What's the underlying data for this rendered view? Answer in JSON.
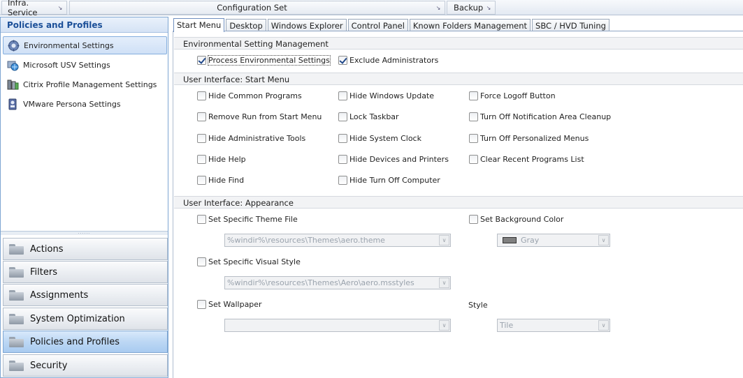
{
  "topbar": {
    "infra": "Infra. Service",
    "config": "Configuration Set",
    "backup": "Backup"
  },
  "left_panel": {
    "header": "Policies and Profiles",
    "items": [
      {
        "label": "Environmental Settings",
        "icon": "environment-gear-icon",
        "selected": true
      },
      {
        "label": "Microsoft USV Settings",
        "icon": "usv-globe-icon"
      },
      {
        "label": "Citrix Profile Management Settings",
        "icon": "citrix-servers-icon"
      },
      {
        "label": "VMware Persona Settings",
        "icon": "vmware-persona-icon"
      }
    ],
    "splitter": "......",
    "buckets": [
      {
        "label": "Actions",
        "icon": "folder-icon"
      },
      {
        "label": "Filters",
        "icon": "folder-icon"
      },
      {
        "label": "Assignments",
        "icon": "folder-icon"
      },
      {
        "label": "System Optimization",
        "icon": "folder-icon"
      },
      {
        "label": "Policies and Profiles",
        "icon": "folder-icon",
        "active": true
      },
      {
        "label": "Security",
        "icon": "folder-icon"
      }
    ]
  },
  "tabs": [
    {
      "label": "Start Menu",
      "active": true
    },
    {
      "label": "Desktop"
    },
    {
      "label": "Windows Explorer"
    },
    {
      "label": "Control Panel"
    },
    {
      "label": "Known Folders Management"
    },
    {
      "label": "SBC / HVD Tuning"
    }
  ],
  "sections": {
    "esm": {
      "title": "Environmental Setting Management",
      "process": {
        "label": "Process Environmental Settings",
        "checked": true
      },
      "exclude": {
        "label": "Exclude Administrators",
        "checked": true
      }
    },
    "start_menu": {
      "title": "User Interface: Start Menu",
      "col1": [
        "Hide Common Programs",
        "Remove Run from Start Menu",
        "Hide Administrative Tools",
        "Hide Help",
        "Hide Find"
      ],
      "col2": [
        "Hide Windows Update",
        "Lock Taskbar",
        "Hide System Clock",
        "Hide Devices and Printers",
        "Hide Turn Off Computer"
      ],
      "col3": [
        "Force Logoff Button",
        "Turn Off Notification Area Cleanup",
        "Turn Off Personalized Menus",
        "Clear Recent Programs List"
      ]
    },
    "appearance": {
      "title": "User Interface: Appearance",
      "theme": {
        "label": "Set Specific Theme File",
        "value": "%windir%\\resources\\Themes\\aero.theme"
      },
      "bgcolor": {
        "label": "Set Background Color",
        "value": "Gray",
        "swatch": "#808080"
      },
      "visual": {
        "label": "Set Specific Visual Style",
        "value": "%windir%\\resources\\Themes\\Aero\\aero.msstyles"
      },
      "wallpaper": {
        "label": "Set Wallpaper",
        "value": ""
      },
      "style": {
        "label": "Style",
        "value": "Tile"
      }
    }
  },
  "colors": {
    "accent": "#1b4f98",
    "selection_bg": "#cfe0f6",
    "checkmark": "#21488a"
  }
}
